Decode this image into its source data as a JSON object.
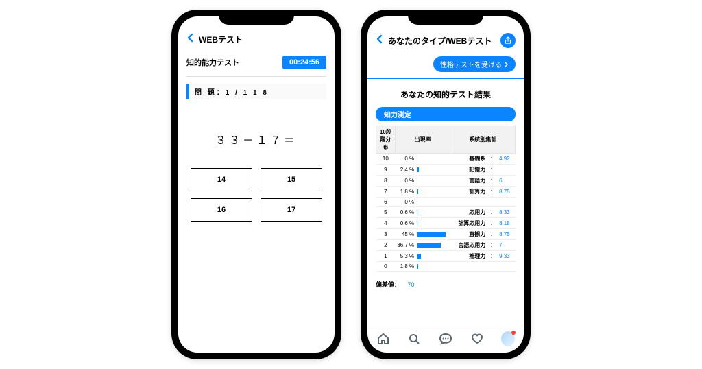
{
  "accent": "#0a84ff",
  "left": {
    "header_title": "WEBテスト",
    "test_name": "知的能力テスト",
    "timer": "00:24:56",
    "question_counter": "問 題：1  /  1 1 8",
    "question_text": "３３－１７＝",
    "answers": [
      "14",
      "15",
      "16",
      "17"
    ]
  },
  "right": {
    "header_title": "あなたのタイプ/WEBテスト",
    "cta": "性格テストを受ける",
    "result_title": "あなたの知的テスト結果",
    "section_tag": "知力測定",
    "col_level": "10段階分布",
    "col_rate": "出現率",
    "col_group": "系統別集計",
    "rows": [
      {
        "level": "10",
        "pct": "0 %",
        "bar": 0,
        "cat": "基礎系",
        "val": "4.92"
      },
      {
        "level": "9",
        "pct": "2.4 %",
        "bar": 3,
        "cat": "記憶力",
        "val": ""
      },
      {
        "level": "8",
        "pct": "0 %",
        "bar": 0,
        "cat": "言語力",
        "val": "6"
      },
      {
        "level": "7",
        "pct": "1.8 %",
        "bar": 2,
        "cat": "計算力",
        "val": "8.75"
      },
      {
        "level": "6",
        "pct": "0 %",
        "bar": 0,
        "cat": "",
        "val": ""
      },
      {
        "level": "5",
        "pct": "0.6 %",
        "bar": 1,
        "cat": "応用力",
        "val": "8.33"
      },
      {
        "level": "4",
        "pct": "0.6 %",
        "bar": 1,
        "cat": "計算応用力",
        "val": "8.18"
      },
      {
        "level": "3",
        "pct": "45 %",
        "bar": 45,
        "cat": "直観力",
        "val": "8.75"
      },
      {
        "level": "2",
        "pct": "36.7 %",
        "bar": 37,
        "cat": "言語応用力",
        "val": "7"
      },
      {
        "level": "1",
        "pct": "5.3 %",
        "bar": 6,
        "cat": "推理力",
        "val": "9.33"
      },
      {
        "level": "0",
        "pct": "1.8 %",
        "bar": 2,
        "cat": "",
        "val": ""
      }
    ],
    "deviation_label": "偏差値：",
    "deviation": "70"
  },
  "chart_data": {
    "type": "bar",
    "title": "出現率",
    "xlabel": "出現率 (%)",
    "ylabel": "10段階分布",
    "categories": [
      "10",
      "9",
      "8",
      "7",
      "6",
      "5",
      "4",
      "3",
      "2",
      "1",
      "0"
    ],
    "values": [
      0,
      2.4,
      0,
      1.8,
      0,
      0.6,
      0.6,
      45,
      36.7,
      5.3,
      1.8
    ],
    "xlim": [
      0,
      50
    ]
  }
}
